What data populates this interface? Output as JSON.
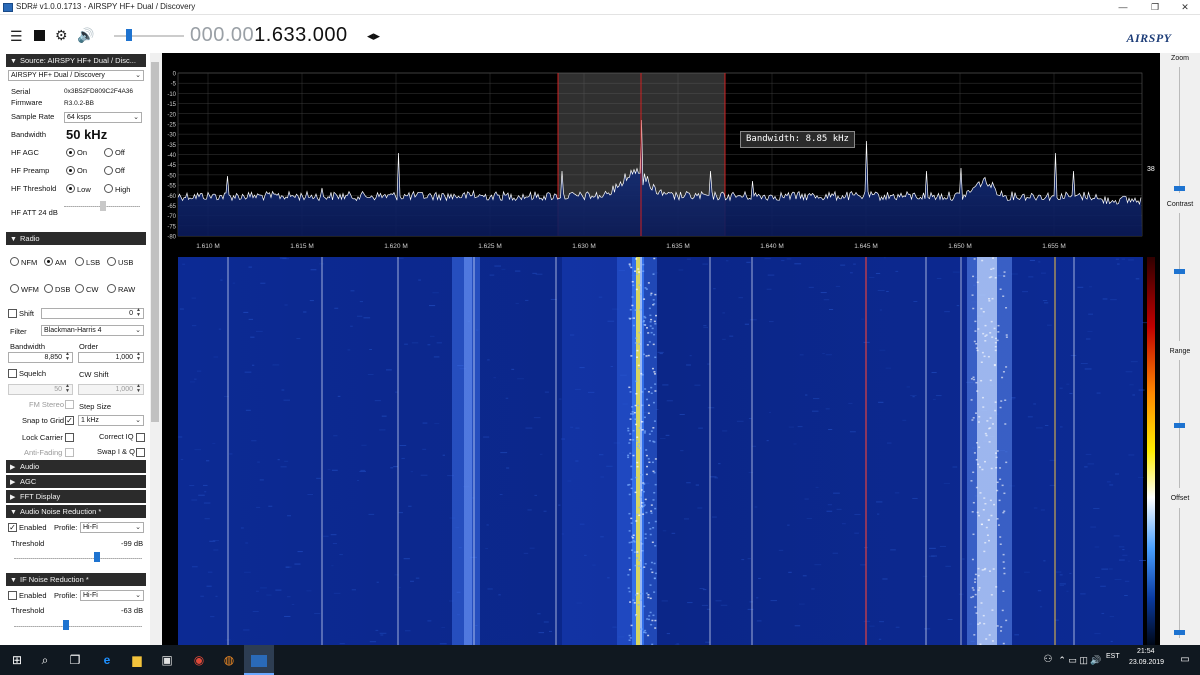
{
  "window": {
    "title": "SDR# v1.0.0.1713 - AIRSPY HF+ Dual / Discovery",
    "minimize": "—",
    "maximize": "❐",
    "close": "✕"
  },
  "toolbar": {
    "freq_dim": "000.00",
    "freq_lit": "1.633.000",
    "freq_arrows": "◂▸",
    "logo": "AIRSPY",
    "volume_level": 0.2
  },
  "source": {
    "header": "Source: AIRSPY HF+ Dual / Disc...",
    "device": "AIRSPY HF+ Dual / Discovery",
    "serial_label": "Serial",
    "serial": "0x3B52FD809C2F4A36",
    "firmware_label": "Firmware",
    "firmware": "R3.0.2-BB",
    "sample_rate_label": "Sample Rate",
    "sample_rate": "64 ksps",
    "bandwidth_label": "Bandwidth",
    "bandwidth": "50 kHz",
    "hf_agc_label": "HF AGC",
    "hf_preamp_label": "HF Preamp",
    "hf_threshold_label": "HF Threshold",
    "on": "On",
    "off": "Off",
    "low": "Low",
    "high": "High",
    "hf_att_label": "HF ATT 24 dB"
  },
  "radio": {
    "header": "Radio",
    "modes_row1": [
      "NFM",
      "AM",
      "LSB",
      "USB"
    ],
    "modes_row2": [
      "WFM",
      "DSB",
      "CW",
      "RAW"
    ],
    "selected_mode": "AM",
    "shift_label": "Shift",
    "shift_value": "0",
    "filter_label": "Filter",
    "filter_value": "Blackman-Harris 4",
    "bandwidth_label": "Bandwidth",
    "order_label": "Order",
    "bandwidth_value": "8,850",
    "order_value": "1,000",
    "squelch_label": "Squelch",
    "cw_shift_label": "CW Shift",
    "squelch_value": "50",
    "cw_shift_value": "1,000",
    "fm_stereo_label": "FM Stereo",
    "step_size_label": "Step Size",
    "snap_label": "Snap to Grid",
    "step_value": "1 kHz",
    "lock_carrier_label": "Lock Carrier",
    "correct_iq_label": "Correct IQ",
    "anti_fading_label": "Anti-Fading",
    "swap_iq_label": "Swap I & Q"
  },
  "sections": {
    "audio": "Audio",
    "agc": "AGC",
    "fft": "FFT Display",
    "anr": "Audio Noise Reduction *",
    "ifnr": "IF Noise Reduction *"
  },
  "anr": {
    "enabled_label": "Enabled",
    "profile_label": "Profile:",
    "profile_value": "Hi-Fi",
    "threshold_label": "Threshold",
    "threshold_value": "-99 dB"
  },
  "ifnr": {
    "enabled_label": "Enabled",
    "profile_label": "Profile:",
    "profile_value": "Hi-Fi",
    "threshold_label": "Threshold",
    "threshold_value": "-63 dB"
  },
  "spectrum": {
    "db_labels": [
      "0",
      "-5",
      "-10",
      "-15",
      "-20",
      "-25",
      "-30",
      "-35",
      "-40",
      "-45",
      "-50",
      "-55",
      "-60",
      "-65",
      "-70",
      "-75",
      "-80"
    ],
    "freq_labels": [
      "1.610 M",
      "1.615 M",
      "1.620 M",
      "1.625 M",
      "1.630 M",
      "1.635 M",
      "1.640 M",
      "1.645 M",
      "1.650 M",
      "1.655 M"
    ],
    "tooltip": "Bandwidth: 8.85 kHz",
    "side_value": "38"
  },
  "right_panel": {
    "zoom": "Zoom",
    "contrast": "Contrast",
    "range": "Range",
    "offset": "Offset"
  },
  "taskbar": {
    "lang": "EST",
    "time": "21:54",
    "date": "23.09.2019"
  },
  "colors": {
    "accent": "#1e73d0",
    "section_header": "#2b2b2b",
    "spectrum_bg": "#000000",
    "waterfall_base": "#0b2a8a",
    "filter_shade": "#5a5a5a",
    "taskbar": "#101820"
  }
}
